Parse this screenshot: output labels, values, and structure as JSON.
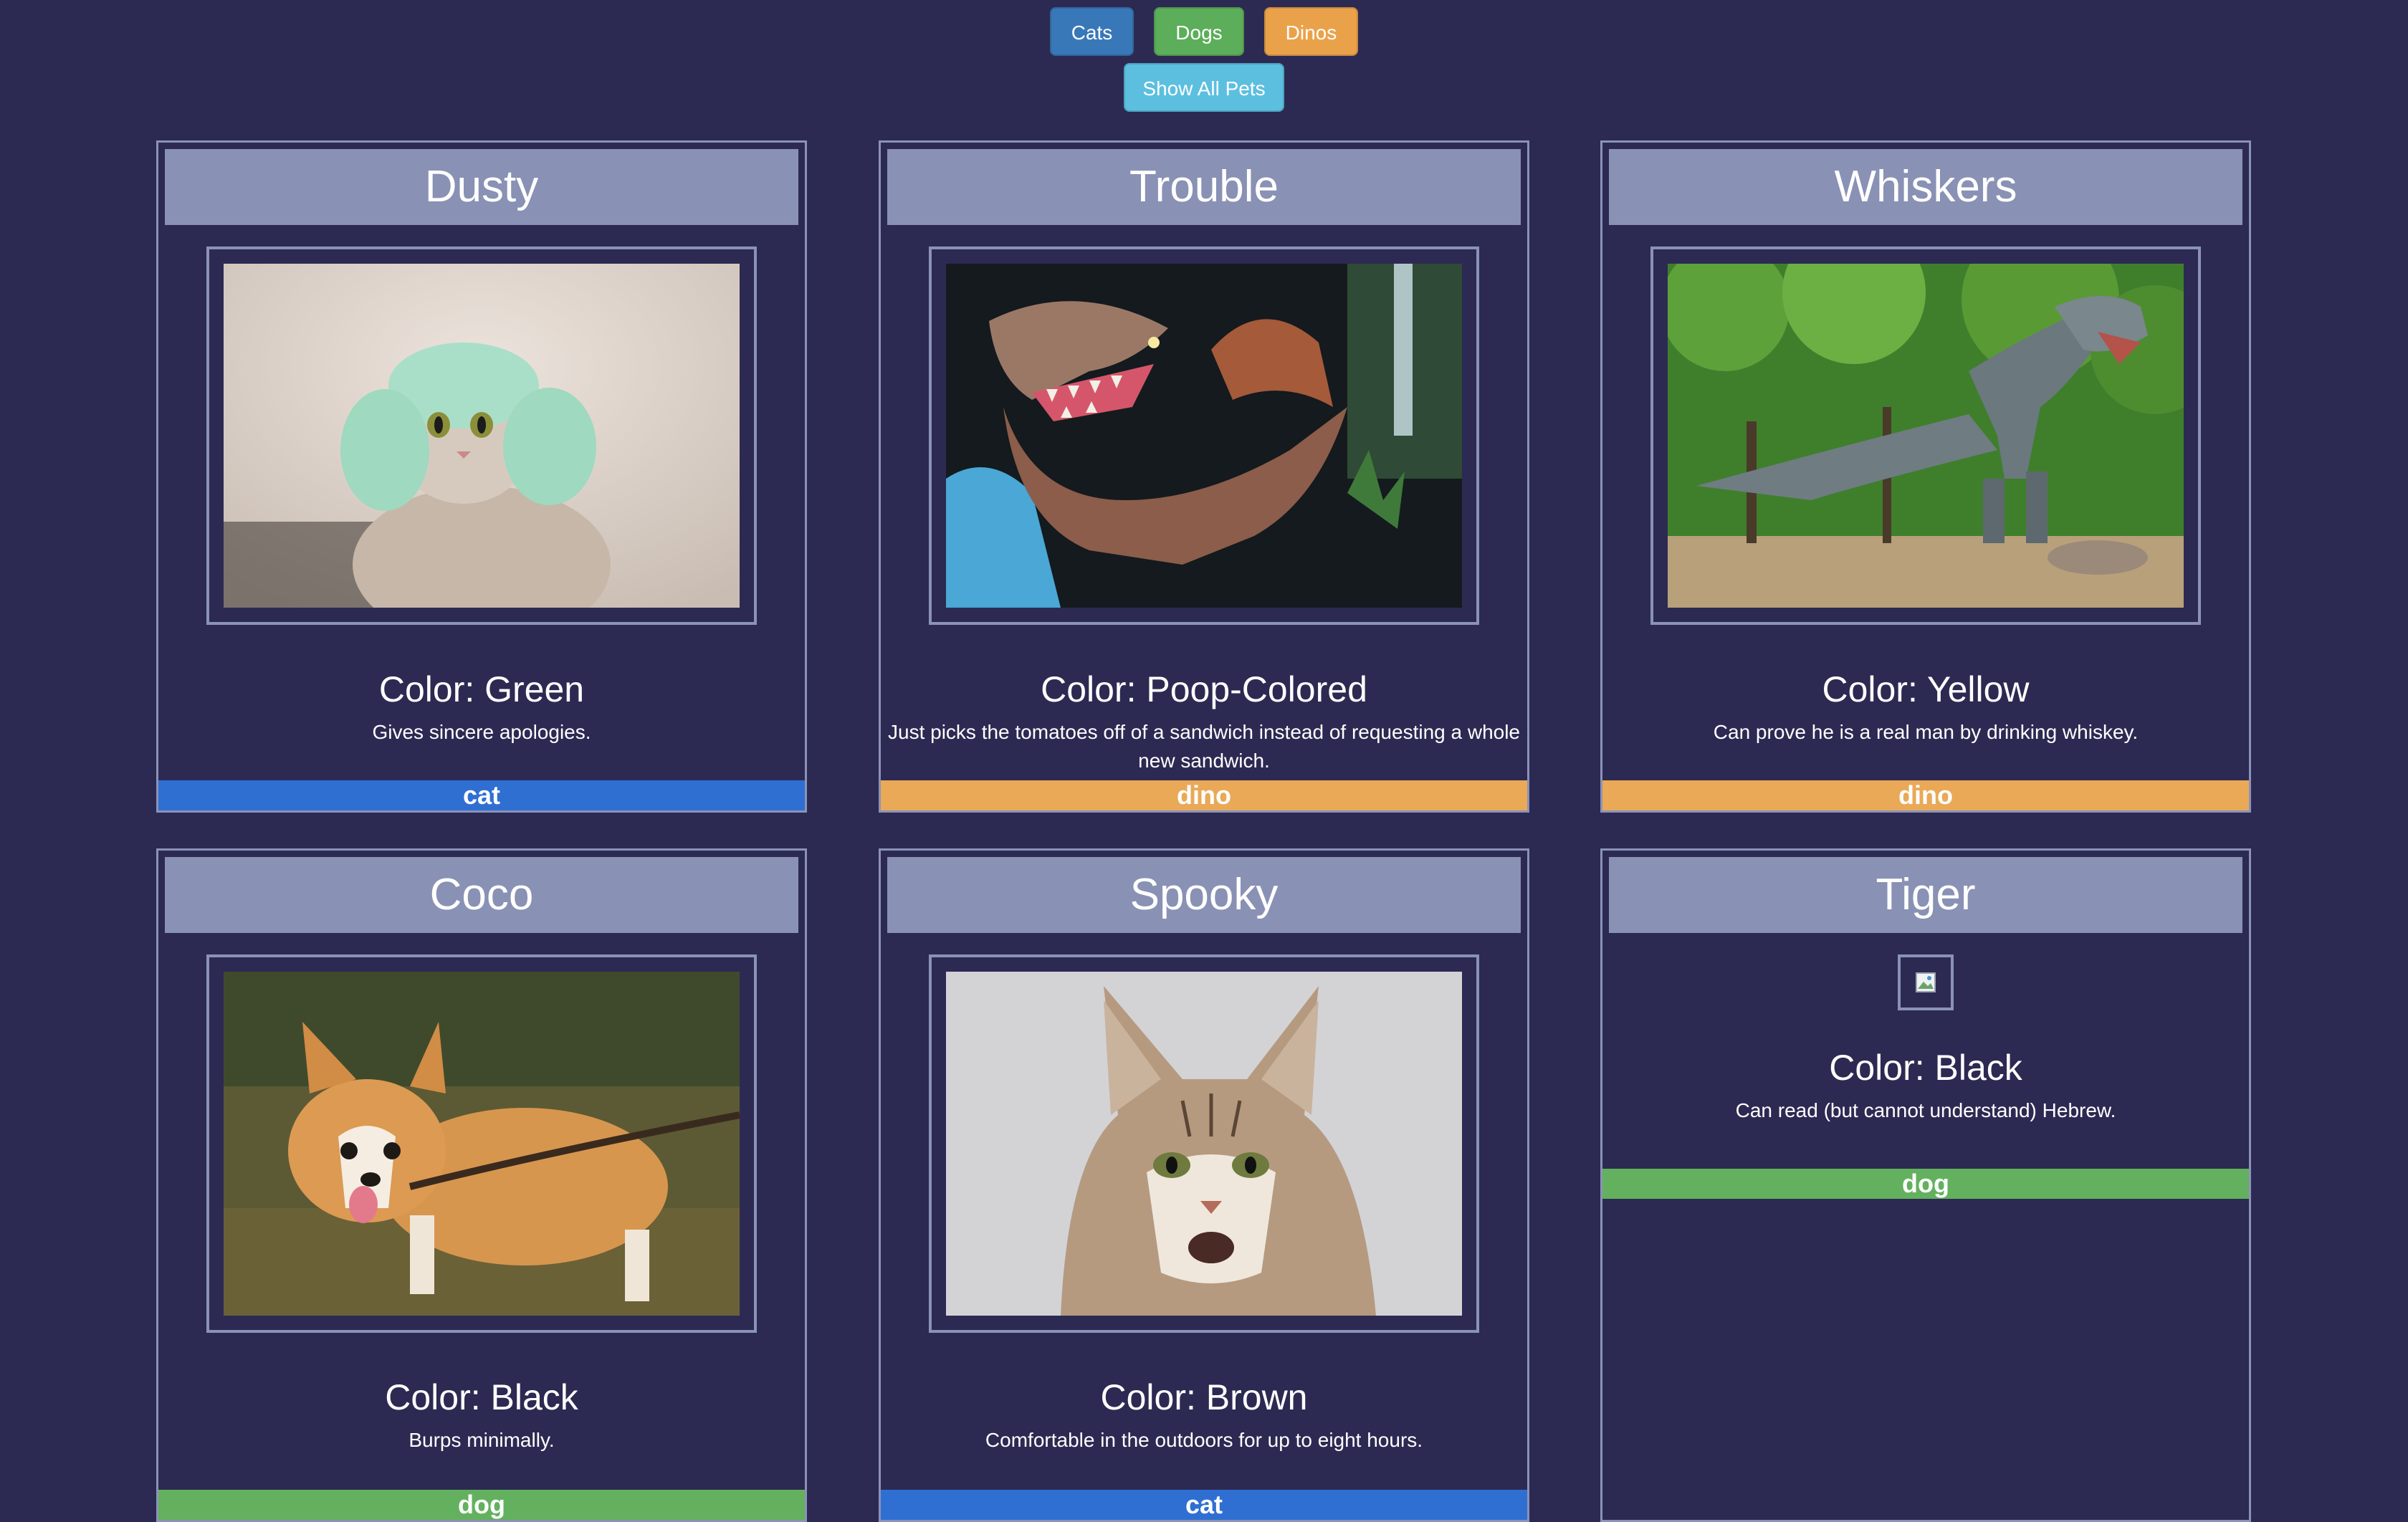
{
  "filters": {
    "cats_label": "Cats",
    "dogs_label": "Dogs",
    "dinos_label": "Dinos",
    "show_all_label": "Show All Pets"
  },
  "colors": {
    "background": "#2c2a52",
    "card_header": "#8991b5",
    "cat": "#2f6fd2",
    "dog": "#63b15e",
    "dino": "#e9a957",
    "show_all": "#5cbfe0"
  },
  "pets": [
    {
      "name": "Dusty",
      "color": "Color: Green",
      "description": "Gives sincere apologies.",
      "type": "cat",
      "image": "cat-in-hat-photo"
    },
    {
      "name": "Trouble",
      "color": "Color: Poop-Colored",
      "description": "Just picks the tomatoes off of a sandwich instead of requesting a whole new sandwich.",
      "type": "dino",
      "image": "spinosaurus-photo"
    },
    {
      "name": "Whiskers",
      "color": "Color: Yellow",
      "description": "Can prove he is a real man by drinking whiskey.",
      "type": "dino",
      "image": "t-rex-photo"
    },
    {
      "name": "Coco",
      "color": "Color: Black",
      "description": "Burps minimally.",
      "type": "dog",
      "image": "corgi-photo"
    },
    {
      "name": "Spooky",
      "color": "Color: Brown",
      "description": "Comfortable in the outdoors for up to eight hours.",
      "type": "cat",
      "image": "maine-coon-photo"
    },
    {
      "name": "Tiger",
      "color": "Color: Black",
      "description": "Can read (but cannot understand) Hebrew.",
      "type": "dog",
      "image": "broken-image-icon"
    }
  ]
}
